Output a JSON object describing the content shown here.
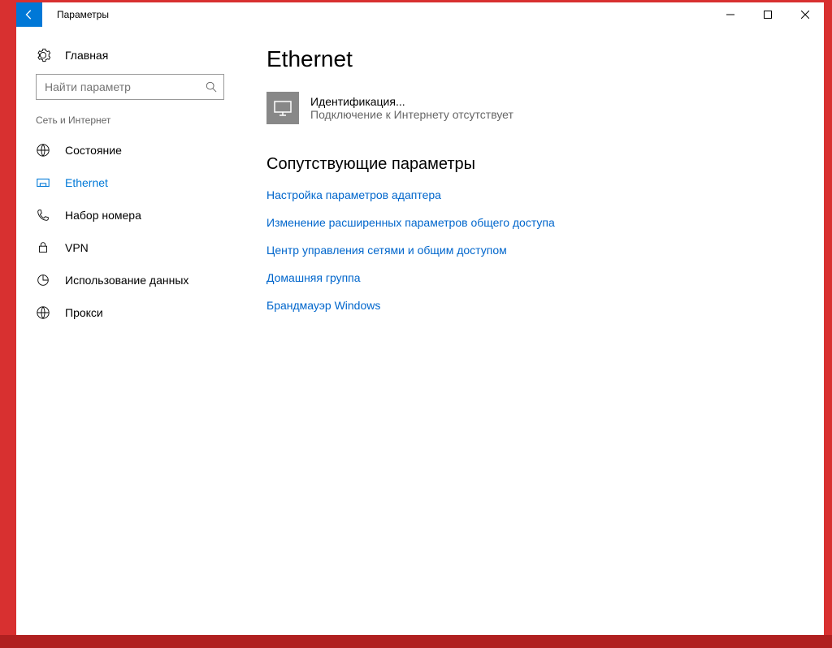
{
  "titlebar": {
    "title": "Параметры"
  },
  "sidebar": {
    "home_label": "Главная",
    "search_placeholder": "Найти параметр",
    "category": "Сеть и Интернет",
    "items": [
      {
        "label": "Состояние",
        "active": false
      },
      {
        "label": "Ethernet",
        "active": true
      },
      {
        "label": "Набор номера",
        "active": false
      },
      {
        "label": "VPN",
        "active": false
      },
      {
        "label": "Использование данных",
        "active": false
      },
      {
        "label": "Прокси",
        "active": false
      }
    ]
  },
  "main": {
    "page_title": "Ethernet",
    "connection": {
      "name": "Идентификация...",
      "status": "Подключение к Интернету отсутствует"
    },
    "related_title": "Сопутствующие параметры",
    "links": [
      "Настройка параметров адаптера",
      "Изменение расширенных параметров общего доступа",
      "Центр управления сетями и общим доступом",
      "Домашняя группа",
      "Брандмауэр Windows"
    ]
  }
}
